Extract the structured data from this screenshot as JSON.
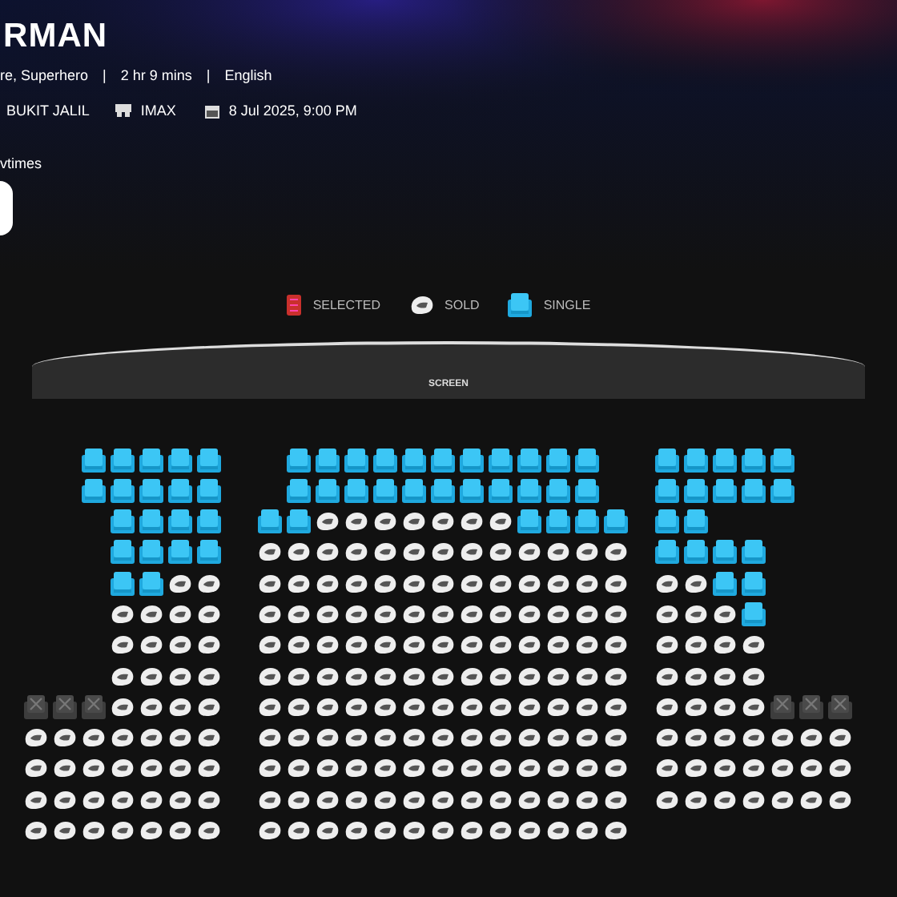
{
  "movie": {
    "title": "RMAN",
    "details": [
      "re, Superhero",
      "|",
      "2 hr 9 mins",
      "|",
      "English"
    ],
    "cinema": "BUKIT JALIL",
    "format": "IMAX",
    "datetime": "8 Jul 2025, 9:00 PM"
  },
  "showtimes": {
    "label": "vtimes"
  },
  "legend": [
    {
      "kind": "selected",
      "label": "SELECTED"
    },
    {
      "kind": "sold",
      "label": "SOLD"
    },
    {
      "kind": "single",
      "label": "SINGLE"
    }
  ],
  "screen": {
    "label": "SCREEN"
  },
  "seat_blocks": [
    {
      "rows": [
        [
          {
            "kind": "gap"
          },
          {
            "kind": "gap"
          },
          {
            "kind": "available"
          },
          {
            "kind": "available"
          },
          {
            "kind": "available"
          },
          {
            "kind": "available"
          },
          {
            "kind": "available"
          }
        ],
        [
          {
            "kind": "gap"
          },
          {
            "kind": "gap"
          },
          {
            "kind": "available"
          },
          {
            "kind": "available"
          },
          {
            "kind": "available"
          },
          {
            "kind": "available"
          },
          {
            "kind": "available"
          }
        ],
        [
          {
            "kind": "gap"
          },
          {
            "kind": "gap"
          },
          {
            "kind": "gap"
          },
          {
            "kind": "available"
          },
          {
            "kind": "available"
          },
          {
            "kind": "available"
          },
          {
            "kind": "available"
          }
        ],
        [
          {
            "kind": "gap"
          },
          {
            "kind": "gap"
          },
          {
            "kind": "gap"
          },
          {
            "kind": "available"
          },
          {
            "kind": "available"
          },
          {
            "kind": "available"
          },
          {
            "kind": "available"
          }
        ],
        [
          {
            "kind": "gap"
          },
          {
            "kind": "gap"
          },
          {
            "kind": "gap"
          },
          {
            "kind": "available"
          },
          {
            "kind": "available"
          },
          {
            "kind": "sold"
          },
          {
            "kind": "sold"
          }
        ],
        [
          {
            "kind": "gap"
          },
          {
            "kind": "gap"
          },
          {
            "kind": "gap"
          },
          {
            "kind": "sold"
          },
          {
            "kind": "sold"
          },
          {
            "kind": "sold"
          },
          {
            "kind": "sold"
          }
        ],
        [
          {
            "kind": "gap"
          },
          {
            "kind": "gap"
          },
          {
            "kind": "gap"
          },
          {
            "kind": "sold"
          },
          {
            "kind": "sold"
          },
          {
            "kind": "sold"
          },
          {
            "kind": "sold"
          }
        ],
        [
          {
            "kind": "gap"
          },
          {
            "kind": "gap"
          },
          {
            "kind": "gap"
          },
          {
            "kind": "sold"
          },
          {
            "kind": "sold"
          },
          {
            "kind": "sold"
          },
          {
            "kind": "sold"
          }
        ],
        [
          {
            "kind": "blocked"
          },
          {
            "kind": "blocked"
          },
          {
            "kind": "blocked"
          },
          {
            "kind": "sold"
          },
          {
            "kind": "sold"
          },
          {
            "kind": "sold"
          },
          {
            "kind": "sold"
          }
        ],
        [
          {
            "kind": "sold"
          },
          {
            "kind": "sold"
          },
          {
            "kind": "sold"
          },
          {
            "kind": "sold"
          },
          {
            "kind": "sold"
          },
          {
            "kind": "sold"
          },
          {
            "kind": "sold"
          }
        ],
        [
          {
            "kind": "sold"
          },
          {
            "kind": "sold"
          },
          {
            "kind": "sold"
          },
          {
            "kind": "sold"
          },
          {
            "kind": "sold"
          },
          {
            "kind": "sold"
          },
          {
            "kind": "sold"
          }
        ],
        [
          {
            "kind": "sold"
          },
          {
            "kind": "sold"
          },
          {
            "kind": "sold"
          },
          {
            "kind": "sold"
          },
          {
            "kind": "sold"
          },
          {
            "kind": "sold"
          },
          {
            "kind": "sold"
          }
        ],
        [
          {
            "kind": "sold"
          },
          {
            "kind": "sold"
          },
          {
            "kind": "sold"
          },
          {
            "kind": "sold"
          },
          {
            "kind": "sold"
          },
          {
            "kind": "sold"
          },
          {
            "kind": "sold"
          }
        ]
      ]
    },
    {
      "rows": [
        [
          {
            "kind": "gap"
          },
          {
            "kind": "available"
          },
          {
            "kind": "available"
          },
          {
            "kind": "available"
          },
          {
            "kind": "available"
          },
          {
            "kind": "available"
          },
          {
            "kind": "available"
          },
          {
            "kind": "available"
          },
          {
            "kind": "available"
          },
          {
            "kind": "available"
          },
          {
            "kind": "available"
          },
          {
            "kind": "available"
          }
        ],
        [
          {
            "kind": "gap"
          },
          {
            "kind": "available"
          },
          {
            "kind": "available"
          },
          {
            "kind": "available"
          },
          {
            "kind": "available"
          },
          {
            "kind": "available"
          },
          {
            "kind": "available"
          },
          {
            "kind": "available"
          },
          {
            "kind": "available"
          },
          {
            "kind": "available"
          },
          {
            "kind": "available"
          },
          {
            "kind": "available"
          }
        ],
        [
          {
            "kind": "available"
          },
          {
            "kind": "available"
          },
          {
            "kind": "sold"
          },
          {
            "kind": "sold"
          },
          {
            "kind": "sold"
          },
          {
            "kind": "sold"
          },
          {
            "kind": "sold"
          },
          {
            "kind": "sold"
          },
          {
            "kind": "sold"
          },
          {
            "kind": "available"
          },
          {
            "kind": "available"
          },
          {
            "kind": "available"
          },
          {
            "kind": "available"
          }
        ],
        [
          {
            "kind": "sold"
          },
          {
            "kind": "sold"
          },
          {
            "kind": "sold"
          },
          {
            "kind": "sold"
          },
          {
            "kind": "sold"
          },
          {
            "kind": "sold"
          },
          {
            "kind": "sold"
          },
          {
            "kind": "sold"
          },
          {
            "kind": "sold"
          },
          {
            "kind": "sold"
          },
          {
            "kind": "sold"
          },
          {
            "kind": "sold"
          },
          {
            "kind": "sold"
          }
        ],
        [
          {
            "kind": "sold"
          },
          {
            "kind": "sold"
          },
          {
            "kind": "sold"
          },
          {
            "kind": "sold"
          },
          {
            "kind": "sold"
          },
          {
            "kind": "sold"
          },
          {
            "kind": "sold"
          },
          {
            "kind": "sold"
          },
          {
            "kind": "sold"
          },
          {
            "kind": "sold"
          },
          {
            "kind": "sold"
          },
          {
            "kind": "sold"
          },
          {
            "kind": "sold"
          }
        ],
        [
          {
            "kind": "sold"
          },
          {
            "kind": "sold"
          },
          {
            "kind": "sold"
          },
          {
            "kind": "sold"
          },
          {
            "kind": "sold"
          },
          {
            "kind": "sold"
          },
          {
            "kind": "sold"
          },
          {
            "kind": "sold"
          },
          {
            "kind": "sold"
          },
          {
            "kind": "sold"
          },
          {
            "kind": "sold"
          },
          {
            "kind": "sold"
          },
          {
            "kind": "sold"
          }
        ],
        [
          {
            "kind": "sold"
          },
          {
            "kind": "sold"
          },
          {
            "kind": "sold"
          },
          {
            "kind": "sold"
          },
          {
            "kind": "sold"
          },
          {
            "kind": "sold"
          },
          {
            "kind": "sold"
          },
          {
            "kind": "sold"
          },
          {
            "kind": "sold"
          },
          {
            "kind": "sold"
          },
          {
            "kind": "sold"
          },
          {
            "kind": "sold"
          },
          {
            "kind": "sold"
          }
        ],
        [
          {
            "kind": "sold"
          },
          {
            "kind": "sold"
          },
          {
            "kind": "sold"
          },
          {
            "kind": "sold"
          },
          {
            "kind": "sold"
          },
          {
            "kind": "sold"
          },
          {
            "kind": "sold"
          },
          {
            "kind": "sold"
          },
          {
            "kind": "sold"
          },
          {
            "kind": "sold"
          },
          {
            "kind": "sold"
          },
          {
            "kind": "sold"
          },
          {
            "kind": "sold"
          }
        ],
        [
          {
            "kind": "sold"
          },
          {
            "kind": "sold"
          },
          {
            "kind": "sold"
          },
          {
            "kind": "sold"
          },
          {
            "kind": "sold"
          },
          {
            "kind": "sold"
          },
          {
            "kind": "sold"
          },
          {
            "kind": "sold"
          },
          {
            "kind": "sold"
          },
          {
            "kind": "sold"
          },
          {
            "kind": "sold"
          },
          {
            "kind": "sold"
          },
          {
            "kind": "sold"
          }
        ],
        [
          {
            "kind": "sold"
          },
          {
            "kind": "sold"
          },
          {
            "kind": "sold"
          },
          {
            "kind": "sold"
          },
          {
            "kind": "sold"
          },
          {
            "kind": "sold"
          },
          {
            "kind": "sold"
          },
          {
            "kind": "sold"
          },
          {
            "kind": "sold"
          },
          {
            "kind": "sold"
          },
          {
            "kind": "sold"
          },
          {
            "kind": "sold"
          },
          {
            "kind": "sold"
          }
        ],
        [
          {
            "kind": "sold"
          },
          {
            "kind": "sold"
          },
          {
            "kind": "sold"
          },
          {
            "kind": "sold"
          },
          {
            "kind": "sold"
          },
          {
            "kind": "sold"
          },
          {
            "kind": "sold"
          },
          {
            "kind": "sold"
          },
          {
            "kind": "sold"
          },
          {
            "kind": "sold"
          },
          {
            "kind": "sold"
          },
          {
            "kind": "sold"
          },
          {
            "kind": "sold"
          }
        ],
        [
          {
            "kind": "sold"
          },
          {
            "kind": "sold"
          },
          {
            "kind": "sold"
          },
          {
            "kind": "sold"
          },
          {
            "kind": "sold"
          },
          {
            "kind": "sold"
          },
          {
            "kind": "sold"
          },
          {
            "kind": "sold"
          },
          {
            "kind": "sold"
          },
          {
            "kind": "sold"
          },
          {
            "kind": "sold"
          },
          {
            "kind": "sold"
          },
          {
            "kind": "sold"
          }
        ],
        [
          {
            "kind": "sold"
          },
          {
            "kind": "sold"
          },
          {
            "kind": "sold"
          },
          {
            "kind": "sold"
          },
          {
            "kind": "sold"
          },
          {
            "kind": "sold"
          },
          {
            "kind": "sold"
          },
          {
            "kind": "sold"
          },
          {
            "kind": "sold"
          },
          {
            "kind": "sold"
          },
          {
            "kind": "sold"
          },
          {
            "kind": "sold"
          },
          {
            "kind": "sold"
          }
        ]
      ]
    },
    {
      "rows": [
        [
          {
            "kind": "available"
          },
          {
            "kind": "available"
          },
          {
            "kind": "available"
          },
          {
            "kind": "available"
          },
          {
            "kind": "available"
          }
        ],
        [
          {
            "kind": "available"
          },
          {
            "kind": "available"
          },
          {
            "kind": "available"
          },
          {
            "kind": "available"
          },
          {
            "kind": "available"
          }
        ],
        [
          {
            "kind": "available"
          },
          {
            "kind": "available"
          }
        ],
        [
          {
            "kind": "available"
          },
          {
            "kind": "available"
          },
          {
            "kind": "available"
          },
          {
            "kind": "available"
          }
        ],
        [
          {
            "kind": "sold"
          },
          {
            "kind": "sold"
          },
          {
            "kind": "available"
          },
          {
            "kind": "available"
          }
        ],
        [
          {
            "kind": "sold"
          },
          {
            "kind": "sold"
          },
          {
            "kind": "sold"
          },
          {
            "kind": "available"
          }
        ],
        [
          {
            "kind": "sold"
          },
          {
            "kind": "sold"
          },
          {
            "kind": "sold"
          },
          {
            "kind": "sold"
          }
        ],
        [
          {
            "kind": "sold"
          },
          {
            "kind": "sold"
          },
          {
            "kind": "sold"
          },
          {
            "kind": "sold"
          }
        ],
        [
          {
            "kind": "sold"
          },
          {
            "kind": "sold"
          },
          {
            "kind": "sold"
          },
          {
            "kind": "sold"
          },
          {
            "kind": "blocked"
          },
          {
            "kind": "blocked"
          },
          {
            "kind": "blocked"
          }
        ],
        [
          {
            "kind": "sold"
          },
          {
            "kind": "sold"
          },
          {
            "kind": "sold"
          },
          {
            "kind": "sold"
          },
          {
            "kind": "sold"
          },
          {
            "kind": "sold"
          },
          {
            "kind": "sold"
          }
        ],
        [
          {
            "kind": "sold"
          },
          {
            "kind": "sold"
          },
          {
            "kind": "sold"
          },
          {
            "kind": "sold"
          },
          {
            "kind": "sold"
          },
          {
            "kind": "sold"
          },
          {
            "kind": "sold"
          }
        ],
        [
          {
            "kind": "sold"
          },
          {
            "kind": "sold"
          },
          {
            "kind": "sold"
          },
          {
            "kind": "sold"
          },
          {
            "kind": "sold"
          },
          {
            "kind": "sold"
          },
          {
            "kind": "sold"
          }
        ]
      ]
    }
  ]
}
